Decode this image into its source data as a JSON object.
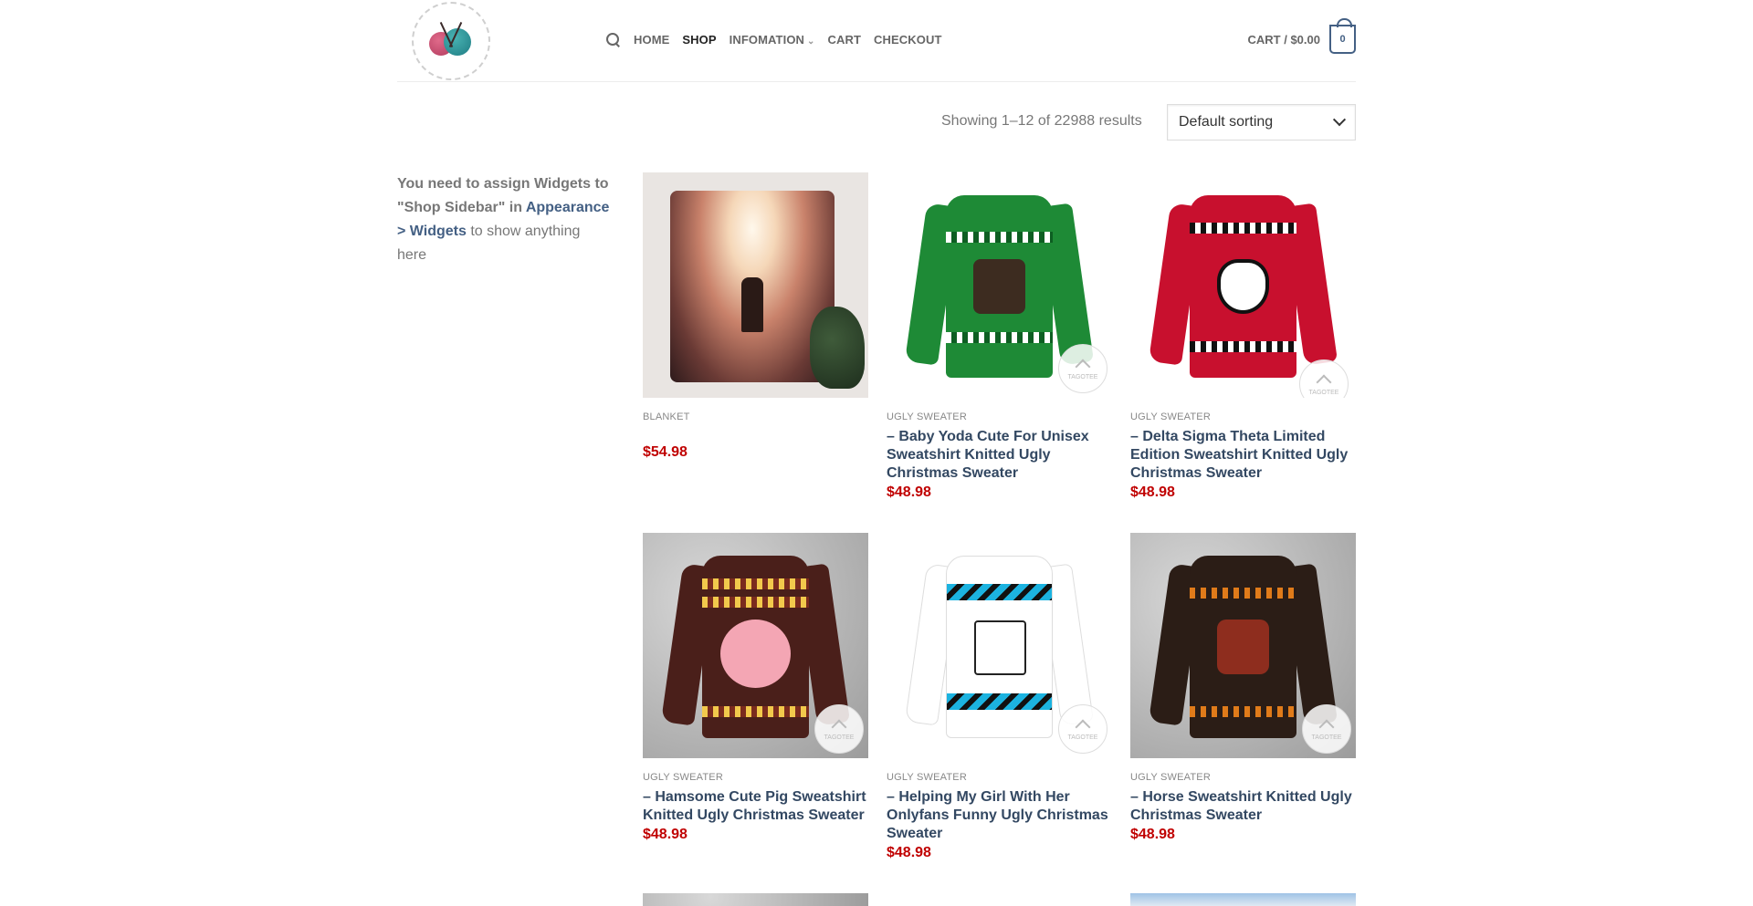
{
  "nav": {
    "items": [
      {
        "label": "HOME"
      },
      {
        "label": "SHOP"
      },
      {
        "label": "INFOMATION"
      },
      {
        "label": "CART"
      },
      {
        "label": "CHECKOUT"
      }
    ]
  },
  "cart": {
    "label": "CART / $0.00",
    "count": "0"
  },
  "toolbar": {
    "result_count": "Showing 1–12 of 22988 results",
    "sort_selected": "Default sorting"
  },
  "sidebar": {
    "text_prefix": "You need to assign Widgets to \"Shop Sidebar\" in ",
    "link": "Appearance > Widgets",
    "text_suffix": " to show anything here"
  },
  "products": [
    {
      "category": "BLANKET",
      "title": "",
      "price": "$54.98"
    },
    {
      "category": "UGLY SWEATER",
      "title": "– Baby Yoda Cute For Unisex Sweatshirt Knitted Ugly Christmas Sweater",
      "price": "$48.98"
    },
    {
      "category": "UGLY SWEATER",
      "title": "– Delta Sigma Theta Limited Edition Sweatshirt Knitted Ugly Christmas Sweater",
      "price": "$48.98"
    },
    {
      "category": "UGLY SWEATER",
      "title": "– Hamsome Cute Pig Sweatshirt Knitted Ugly Christmas Sweater",
      "price": "$48.98"
    },
    {
      "category": "UGLY SWEATER",
      "title": "– Helping My Girl With Her Onlyfans Funny Ugly Christmas Sweater",
      "price": "$48.98"
    },
    {
      "category": "UGLY SWEATER",
      "title": "– Horse Sweatshirt Knitted Ugly Christmas Sweater",
      "price": "$48.98"
    }
  ],
  "watermark_text": "TAGOTEE",
  "colors": {
    "primary": "#446084",
    "price": "#c00000",
    "title": "#334862"
  }
}
